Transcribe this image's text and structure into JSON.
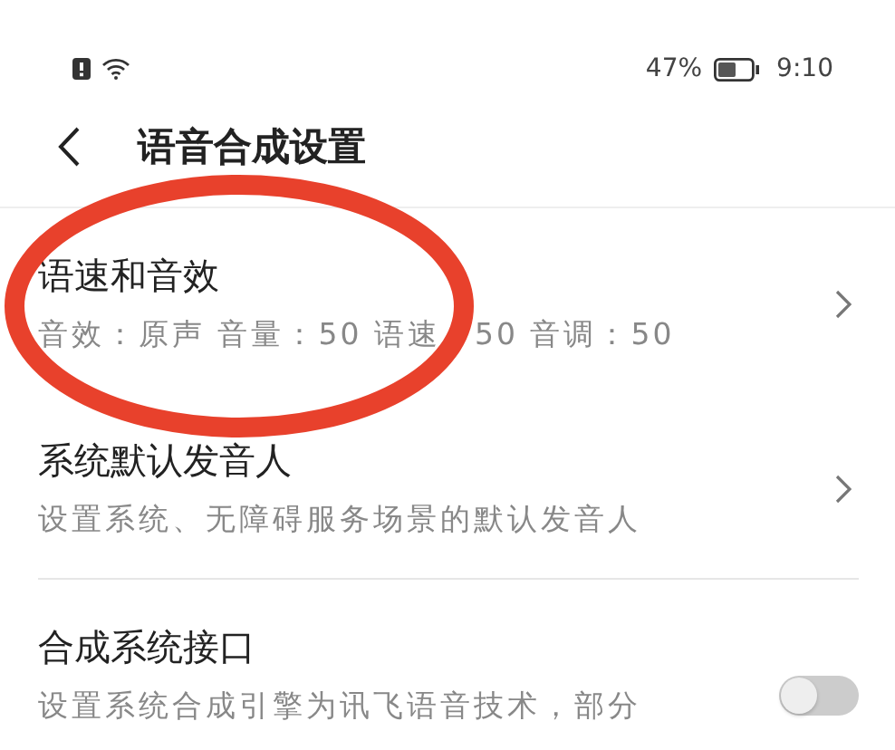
{
  "status_bar": {
    "battery": "47%",
    "time": "9:10"
  },
  "header": {
    "title": "语音合成设置"
  },
  "items": [
    {
      "kind": "link",
      "title": "语速和音效",
      "subtitle": "音效：原声 音量：50 语速　50 音调：50",
      "divider": false
    },
    {
      "kind": "link",
      "title": "系统默认发音人",
      "subtitle": "设置系统、无障碍服务场景的默认发音人",
      "divider": true
    },
    {
      "kind": "switch",
      "title": "合成系统接口",
      "subtitle": "设置系统合成引擎为讯飞语音技术，部分",
      "on": false,
      "divider": false
    }
  ]
}
